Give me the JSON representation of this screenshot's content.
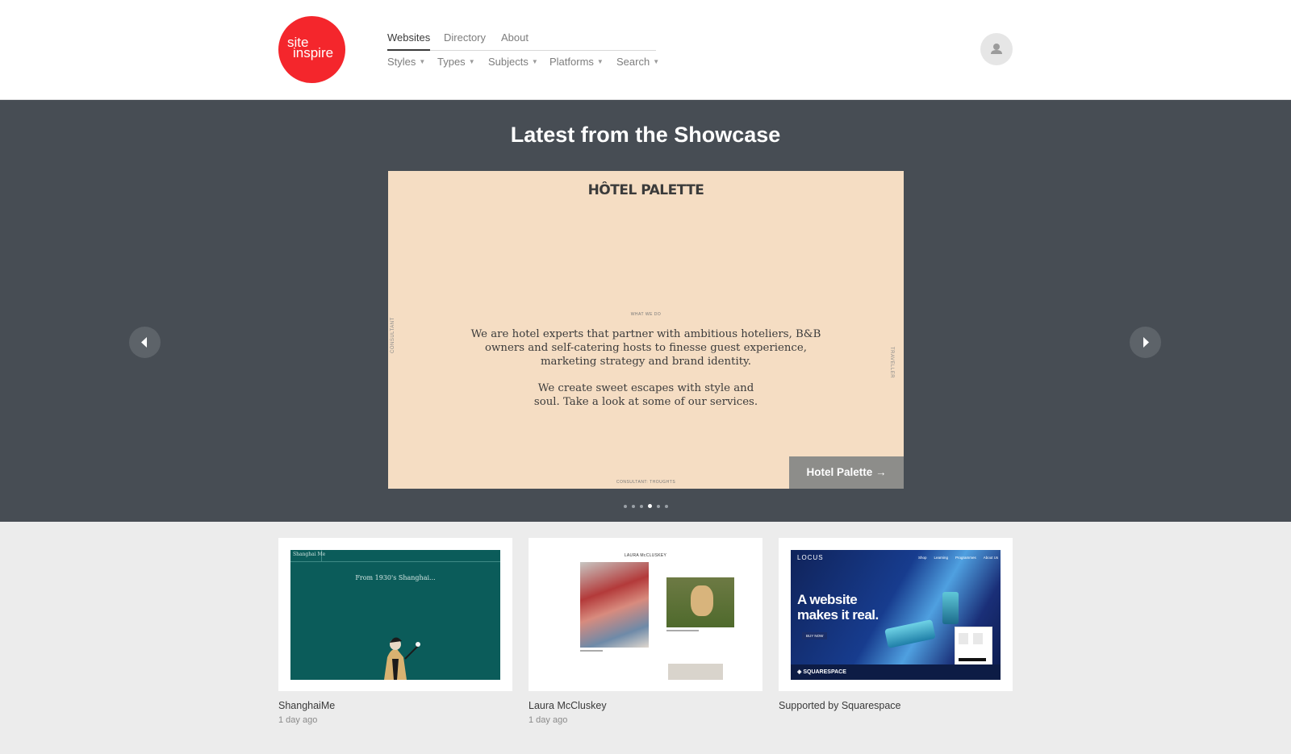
{
  "logo": {
    "line1": "site",
    "line2": "inspire"
  },
  "nav": {
    "main": [
      "Websites",
      "Directory",
      "About"
    ],
    "sub": [
      "Styles",
      "Types",
      "Subjects",
      "Platforms",
      "Search"
    ]
  },
  "user_icon": "user-icon",
  "showcase": {
    "title": "Latest from the Showcase",
    "slide": {
      "brand": "HÔTEL PALETTE",
      "label_top": "WHAT WE DO",
      "side_left": "CONSULTANT",
      "side_right": "TRAVELLER",
      "para1": "We are hotel experts that partner with ambitious hoteliers, B&B owners and self-catering hosts to finesse guest experience, marketing strategy and brand identity.",
      "para2": "We create sweet escapes with style and soul. Take a look at some of our services.",
      "label_bottom": "CONSULTANT: THOUGHTS",
      "link": "Hotel Palette →"
    },
    "dots": 6,
    "active_dot": 3
  },
  "cards": [
    {
      "title": "ShanghaiMe",
      "date": "1 day ago",
      "thumb_header": "Shanghai Me",
      "thumb_text": "From 1930's Shanghai..."
    },
    {
      "title": "Laura McCluskey",
      "date": "1 day ago",
      "thumb_header": "LAURA McCLUSKEY"
    },
    {
      "title": "Supported by Squarespace",
      "date": "",
      "thumb_brand": "LOCUS",
      "thumb_headline1": "A website",
      "thumb_headline2": "makes it real.",
      "thumb_cta": "BUY NOW",
      "thumb_sponsor": "SQUARESPACE",
      "thumb_nav": [
        "Shop",
        "Learning",
        "Programmes",
        "About Us"
      ]
    }
  ],
  "colors": {
    "logo_red": "#f4262c",
    "showcase_bg": "#474d54",
    "slide_bg": "#f5ddc3",
    "card_teal": "#0b5c5a"
  }
}
